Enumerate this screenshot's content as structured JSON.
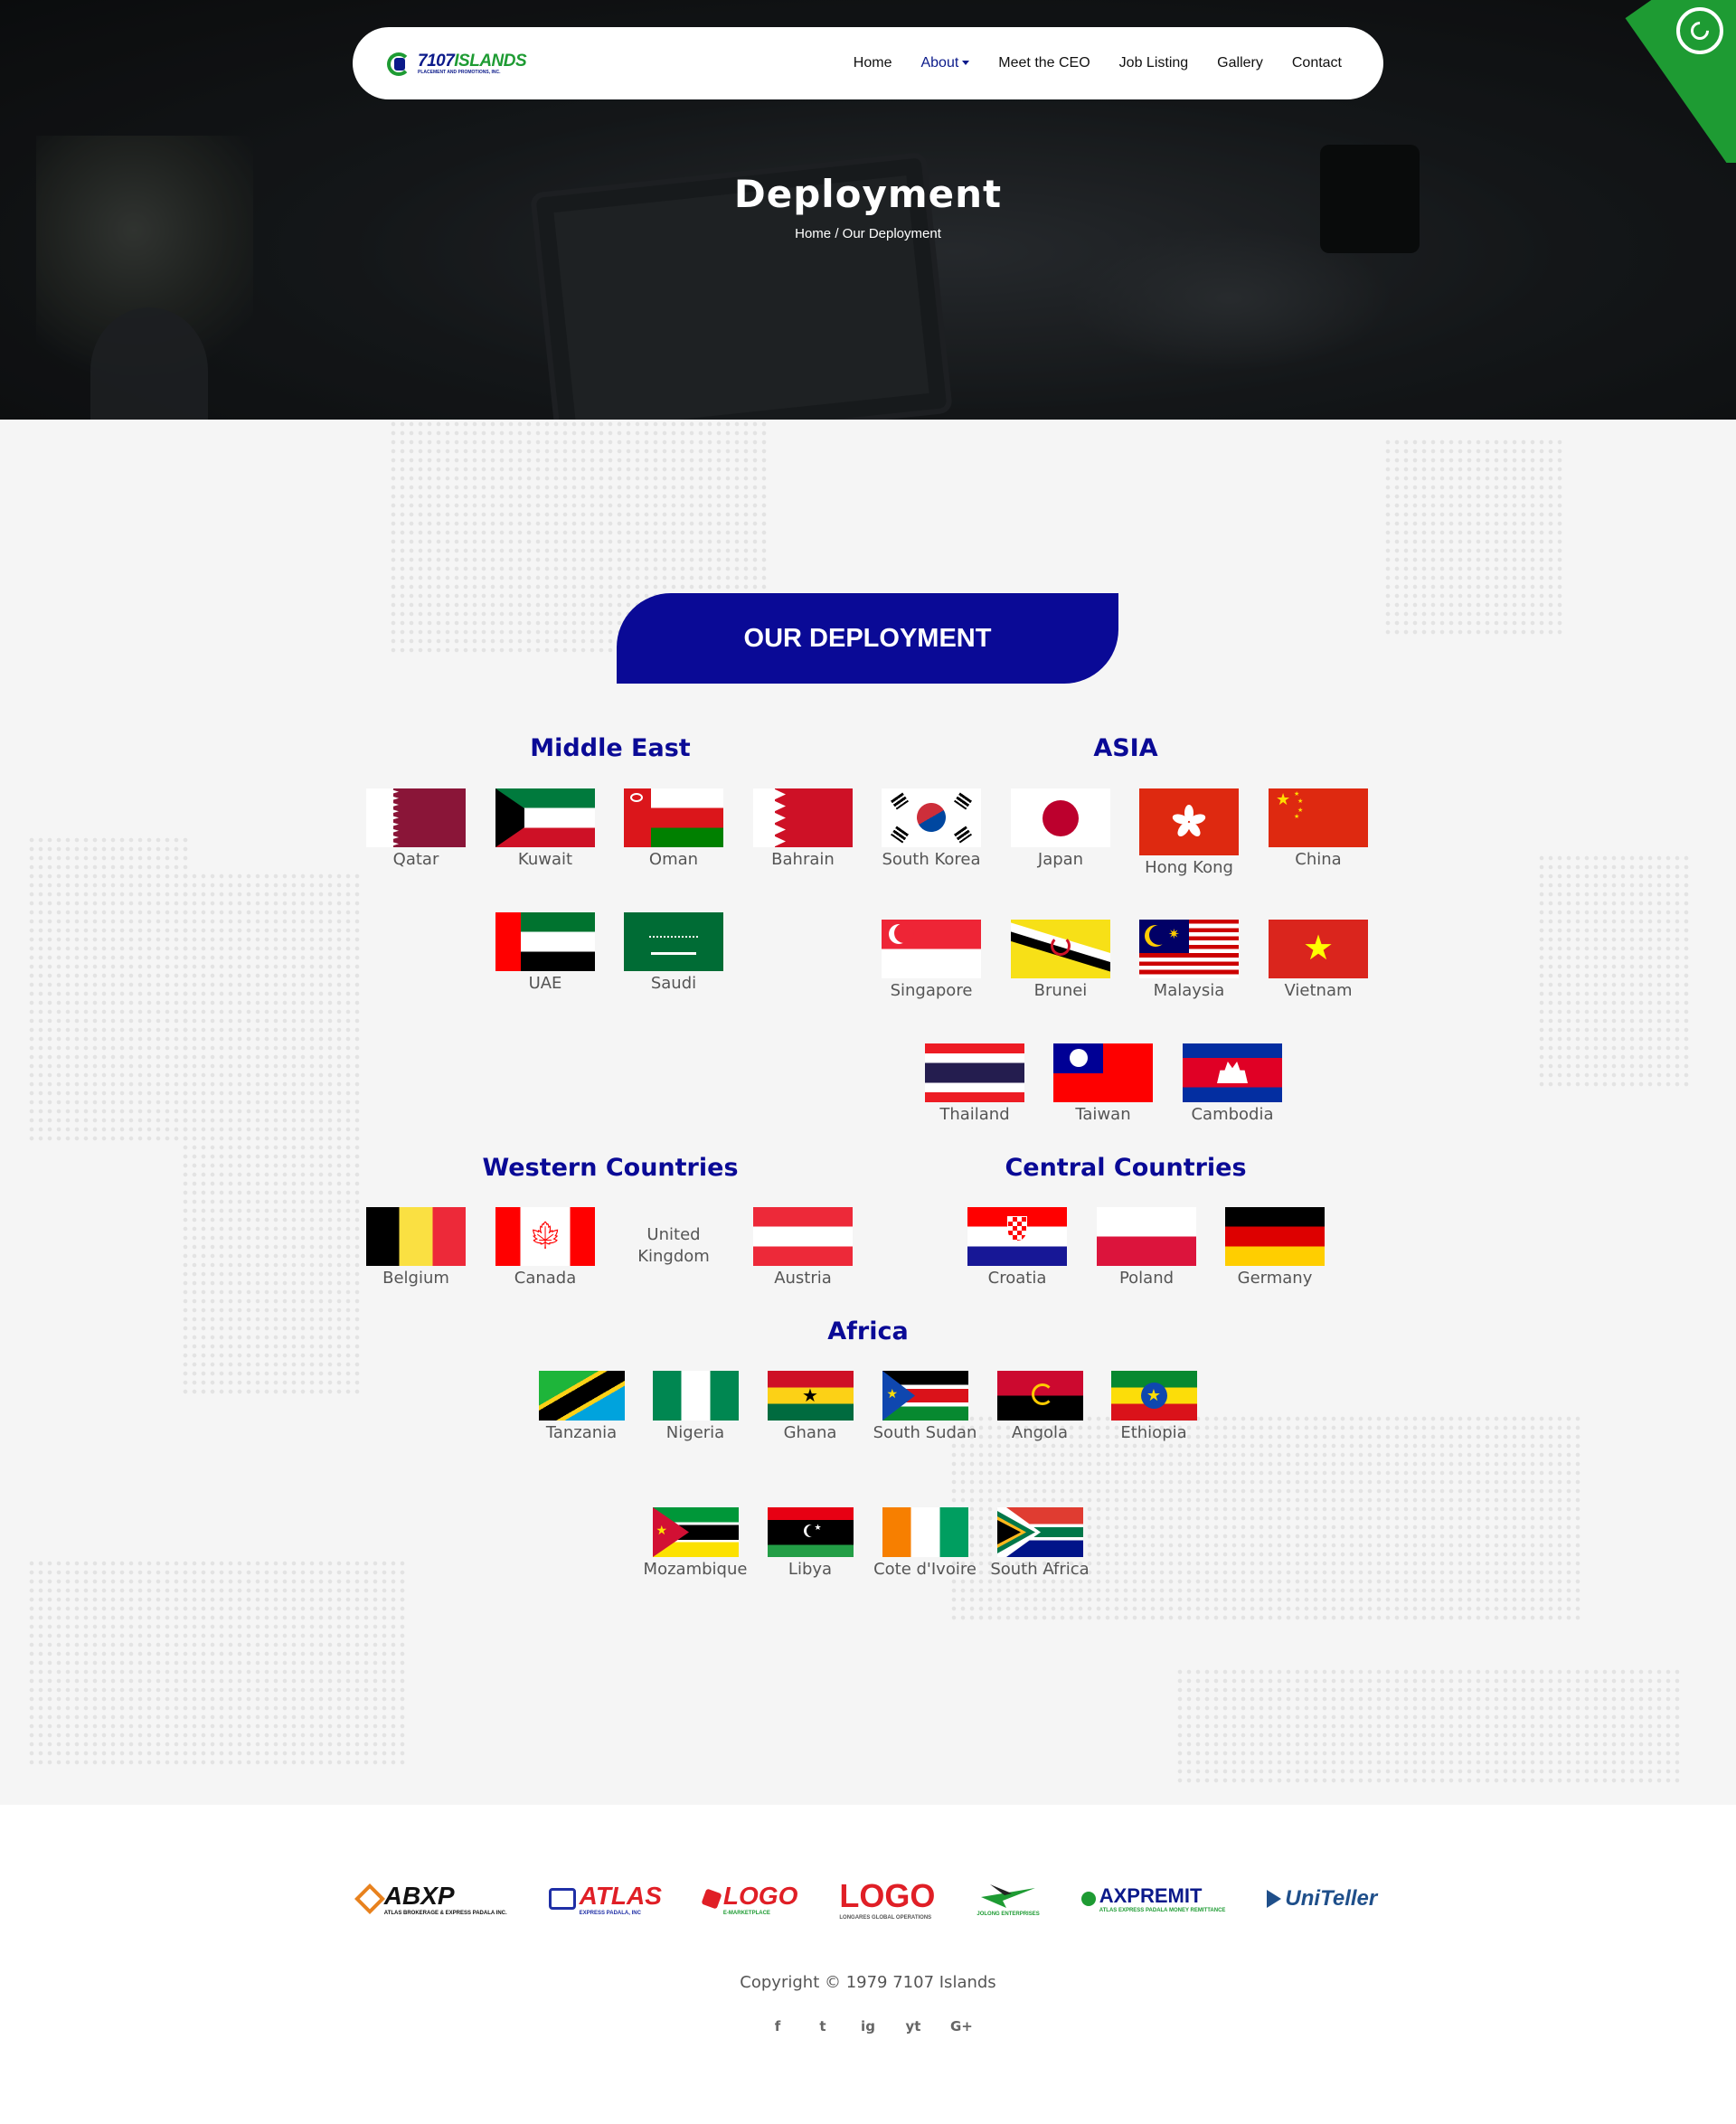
{
  "nav": {
    "logo_main": "7107",
    "logo_accent": "ISLANDS",
    "logo_sub": "PLACEMENT AND PROMOTIONS, INC.",
    "items": [
      "Home",
      "About",
      "Meet the CEO",
      "Job Listing",
      "Gallery",
      "Contact"
    ]
  },
  "hero": {
    "title": "Deployment",
    "crumb_home": "Home",
    "crumb_current": "/ Our Deployment"
  },
  "section": {
    "badge": "OUR DEPLOYMENT"
  },
  "regions": {
    "middle_east": {
      "title": "Middle East",
      "countries": [
        "Qatar",
        "Kuwait",
        "Oman",
        "Bahrain",
        "UAE",
        "Saudi"
      ]
    },
    "asia": {
      "title": "ASIA",
      "countries": [
        "South Korea",
        "Japan",
        "Hong Kong",
        "China",
        "Singapore",
        "Brunei",
        "Malaysia",
        "Vietnam",
        "Thailand",
        "Taiwan",
        "Cambodia"
      ]
    },
    "western": {
      "title": "Western Countries",
      "countries": [
        "Belgium",
        "Canada",
        "United Kingdom",
        "Austria"
      ]
    },
    "central": {
      "title": "Central Countries",
      "countries": [
        "Croatia",
        "Poland",
        "Germany"
      ]
    },
    "africa": {
      "title": "Africa",
      "countries": [
        "Tanzania",
        "Nigeria",
        "Ghana",
        "South Sudan",
        "Angola",
        "Ethiopia",
        "Mozambique",
        "Libya",
        "Cote d'Ivoire",
        "South Africa"
      ]
    }
  },
  "footer": {
    "partners": [
      "ABXP",
      "ATLAS",
      "LOGO",
      "LOGO",
      "JOLONG ENTERPRISES",
      "AXPREMIT",
      "UniTeller"
    ],
    "partner_subs": [
      "ATLAS BROKERAGE & EXPRESS PADALA INC.",
      "EXPRESS PADALA, INC",
      "E-MARKETPLACE",
      "LONGARES GLOBAL OPERATIONS",
      "",
      "ATLAS EXPRESS PADALA MONEY REMITTANCE",
      ""
    ],
    "copyright": "Copyright © 1979 7107 Islands",
    "social": [
      "f",
      "t",
      "ig",
      "yt",
      "G+"
    ]
  },
  "icons": [
    "whatsapp-icon",
    "facebook-icon",
    "twitter-icon",
    "instagram-icon",
    "youtube-icon",
    "google-plus-icon"
  ],
  "colors": {
    "primary": "#0a0a96",
    "green": "#1e9b33"
  }
}
